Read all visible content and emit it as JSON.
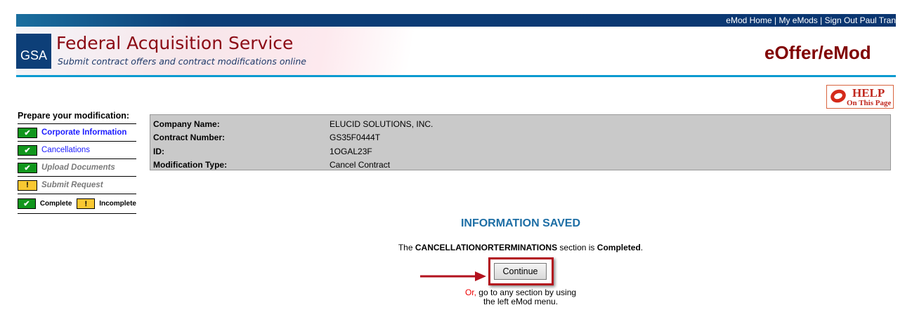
{
  "topnav": {
    "home": "eMod Home",
    "sep": " | ",
    "my": "My eMods",
    "signout": "Sign Out Paul Tran"
  },
  "header": {
    "logo": "GSA",
    "title": "Federal Acquisition Service",
    "subtitle": "Submit contract offers and contract modifications online",
    "brand": "eOffer/eMod"
  },
  "help": {
    "line1": "HELP",
    "line2": "On This Page"
  },
  "sidebar": {
    "title": "Prepare your modification:",
    "items": [
      {
        "label": "Corporate Information",
        "status": "complete"
      },
      {
        "label": "Cancellations",
        "status": "complete"
      },
      {
        "label": "Upload Documents",
        "status": "complete"
      },
      {
        "label": "Submit Request",
        "status": "incomplete"
      }
    ],
    "legend": {
      "complete": "Complete",
      "incomplete": "Incomplete"
    }
  },
  "info": [
    {
      "label": "Company Name:",
      "value": "ELUCID SOLUTIONS, INC."
    },
    {
      "label": "Contract Number:",
      "value": "GS35F0444T"
    },
    {
      "label": "ID:",
      "value": "1OGAL23F"
    },
    {
      "label": "Modification Type:",
      "value": "Cancel Contract"
    }
  ],
  "main": {
    "heading": "INFORMATION SAVED",
    "msg_pre": "The ",
    "msg_section": "CANCELLATIONORTERMINATIONS",
    "msg_mid": " section is ",
    "msg_status": "Completed",
    "msg_end": ".",
    "continue": "Continue",
    "or": "Or,",
    "or_rest": " go to any section by using",
    "or_line2": "the left eMod menu."
  },
  "colors": {
    "topbar": "#0a3570",
    "accent_line": "#0a9ad0",
    "title": "#8b0a14",
    "heading": "#1d6ea5",
    "highlight": "#b3121e",
    "complete": "#11961d",
    "incomplete": "#f9c832"
  }
}
